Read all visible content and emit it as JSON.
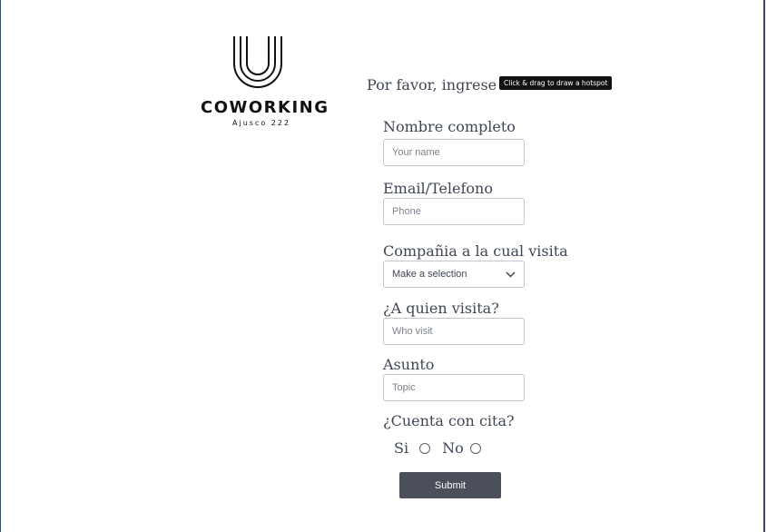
{
  "logo": {
    "word": "COWORKING",
    "sub": "Ajusco 222"
  },
  "prompt": "Por favor, ingrese su",
  "tooltip": "Click & drag to draw a hotspot",
  "form": {
    "name": {
      "label": "Nombre completo",
      "placeholder": "Your name"
    },
    "contact": {
      "label": "Email/Telefono",
      "placeholder": "Phone"
    },
    "company": {
      "label": "Compañia a la cual visita",
      "selected": "Make a selection"
    },
    "visitee": {
      "label": "¿A quien visita?",
      "placeholder": "Who visit"
    },
    "topic": {
      "label": "Asunto",
      "placeholder": "Topic"
    },
    "appointment": {
      "label": "¿Cuenta con cita?",
      "yes": "Si",
      "no": "No"
    },
    "submit": "Submit"
  }
}
